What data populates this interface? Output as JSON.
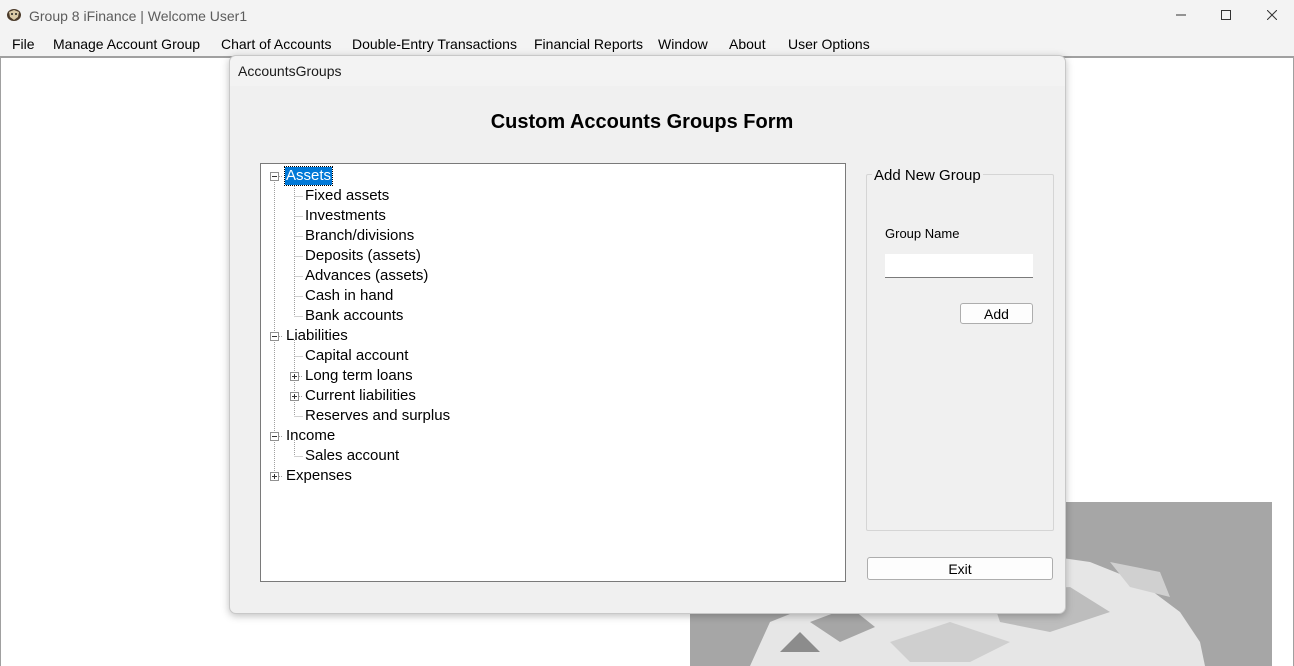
{
  "window": {
    "title": "Group 8 iFinance | Welcome User1",
    "icon": "app-logo-icon",
    "controls": [
      "minimize-icon",
      "maximize-icon",
      "close-icon"
    ]
  },
  "menu": {
    "items": [
      {
        "label": "File"
      },
      {
        "label": "Manage Account Group"
      },
      {
        "label": "Chart of Accounts"
      },
      {
        "label": "Double-Entry Transactions"
      },
      {
        "label": "Financial Reports"
      },
      {
        "label": "Window"
      },
      {
        "label": "About"
      },
      {
        "label": "User Options"
      }
    ]
  },
  "child": {
    "title": "AccountsGroups",
    "heading": "Custom Accounts Groups Form",
    "tree": {
      "nodes": [
        {
          "label": "Assets",
          "expanded": true,
          "selected": true
        },
        {
          "label": "Fixed assets"
        },
        {
          "label": "Investments"
        },
        {
          "label": "Branch/divisions"
        },
        {
          "label": "Deposits (assets)"
        },
        {
          "label": "Advances (assets)"
        },
        {
          "label": "Cash in hand"
        },
        {
          "label": "Bank accounts"
        },
        {
          "label": "Liabilities",
          "expanded": true
        },
        {
          "label": "Capital account"
        },
        {
          "label": "Long term loans",
          "expanded": false
        },
        {
          "label": "Current liabilities",
          "expanded": false
        },
        {
          "label": "Reserves and surplus"
        },
        {
          "label": "Income",
          "expanded": true
        },
        {
          "label": "Sales account"
        },
        {
          "label": "Expenses",
          "expanded": false
        }
      ]
    },
    "add_group": {
      "caption": "Add New Group",
      "field_label": "Group Name",
      "field_value": "",
      "add_label": "Add"
    },
    "exit_label": "Exit"
  },
  "colors": {
    "selection": "#0078d7",
    "window_bg": "#f0f0f0",
    "logo_bg": "#a6a6a6"
  }
}
